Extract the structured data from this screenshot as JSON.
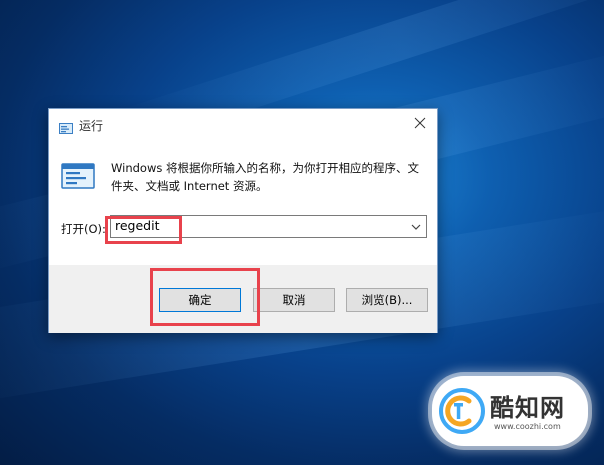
{
  "dialog": {
    "title": "运行",
    "description": "Windows 将根据你所输入的名称，为你打开相应的程序、文件夹、文档或 Internet 资源。",
    "open_label": "打开(O):",
    "command_value": "regedit",
    "buttons": {
      "ok": "确定",
      "cancel": "取消",
      "browse": "浏览(B)..."
    },
    "icons": {
      "title": "run-icon",
      "app": "run-icon",
      "close": "close-icon",
      "dropdown": "chevron-down-icon"
    }
  },
  "annotations": {
    "highlight_color": "#e8424c"
  },
  "watermark": {
    "name": "酷知网",
    "url": "www.coozhi.com"
  },
  "colors": {
    "desktop_blue": "#0e5fb0",
    "dialog_footer": "#f0f0f0",
    "focus_border": "#0078d7"
  }
}
